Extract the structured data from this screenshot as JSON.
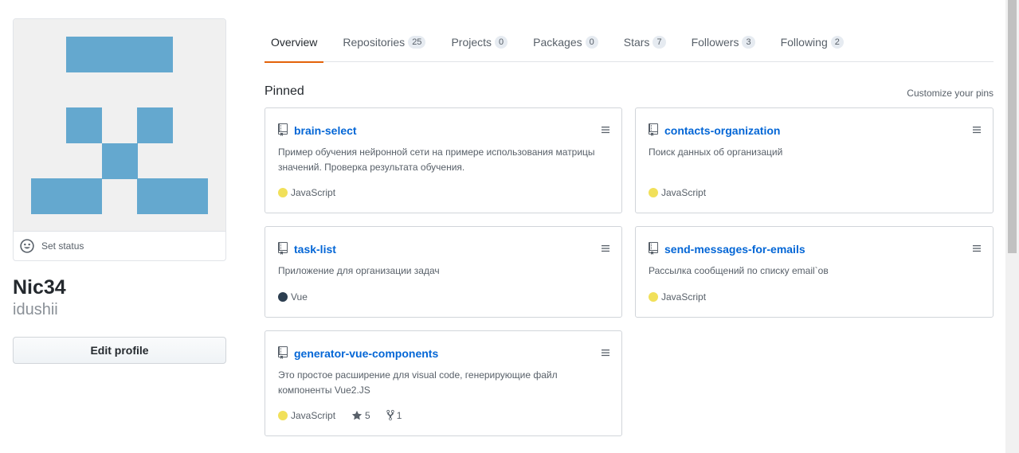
{
  "profile": {
    "set_status_label": "Set status",
    "fullname": "Nic34",
    "username": "idushii",
    "edit_profile_label": "Edit profile",
    "avatar_color": "#64a8cf"
  },
  "tabs": [
    {
      "label": "Overview",
      "count": null,
      "active": true
    },
    {
      "label": "Repositories",
      "count": "25"
    },
    {
      "label": "Projects",
      "count": "0"
    },
    {
      "label": "Packages",
      "count": "0"
    },
    {
      "label": "Stars",
      "count": "7"
    },
    {
      "label": "Followers",
      "count": "3"
    },
    {
      "label": "Following",
      "count": "2"
    }
  ],
  "pinned": {
    "title": "Pinned",
    "customize_label": "Customize your pins",
    "repos": [
      {
        "name": "brain-select",
        "description": "Пример обучения нейронной сети на примере использования матрицы значений. Проверка результата обучения.",
        "language": "JavaScript",
        "language_color": "#f1e05a"
      },
      {
        "name": "contacts-organization",
        "description": "Поиск данных об организаций",
        "language": "JavaScript",
        "language_color": "#f1e05a"
      },
      {
        "name": "task-list",
        "description": "Приложение для организации задач",
        "language": "Vue",
        "language_color": "#2c3e50"
      },
      {
        "name": "send-messages-for-emails",
        "description": "Рассылка сообщений по списку email`ов",
        "language": "JavaScript",
        "language_color": "#f1e05a"
      },
      {
        "name": "generator-vue-components",
        "description": "Это простое расширение для visual code, генерирующие файл компоненты Vue2.JS",
        "language": "JavaScript",
        "language_color": "#f1e05a",
        "stars": "5",
        "forks": "1"
      }
    ]
  },
  "colors": {
    "accent_tab": "#e36209",
    "link": "#0366d6"
  }
}
